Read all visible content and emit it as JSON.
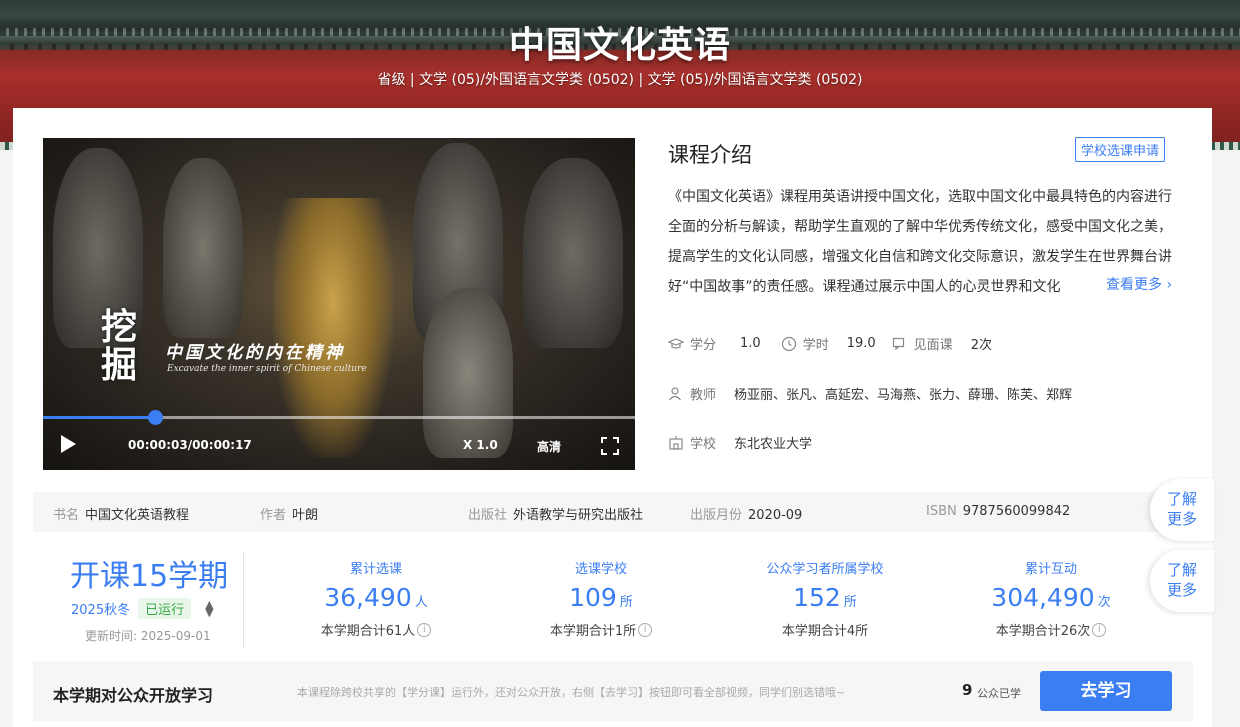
{
  "banner": {
    "title": "中国文化英语",
    "subtitle": "省级 | 文学 (05)/外国语言文学类 (0502) | 文学 (05)/外国语言文学类 (0502)"
  },
  "video": {
    "calligraphy_big": "挖掘",
    "calligraphy_line": "中国文化的内在精神",
    "calligraphy_en": "Excavate the inner spirit of Chinese culture",
    "time": "00:00:03/00:00:17",
    "speed": "X 1.0",
    "quality": "高清",
    "progress": 0.19
  },
  "intro": {
    "heading": "课程介绍",
    "apply_label": "学校选课申请",
    "lines": [
      "《中国文化英语》课程用英语讲授中国文化，选取中国文化中最具特色的内容进行",
      "全面的分析与解读，帮助学生直观的了解中华优秀传统文化，感受中国文化之美，",
      "提高学生的文化认同感，增强文化自信和跨文化交际意识，激发学生在世界舞台讲",
      "好“中国故事”的责任感。课程通过展示中国人的心灵世界和文化"
    ],
    "more_label": "查看更多"
  },
  "meta": {
    "credit_label": "学分",
    "credit_value": "1.0",
    "hours_label": "学时",
    "hours_value": "19.0",
    "meet_label": "见面课",
    "meet_value": "2次",
    "teacher_label": "教师",
    "teachers": "杨亚丽、张凡、高延宏、马海燕、张力、薛珊、陈芙、郑辉",
    "school_label": "学校",
    "school": "东北农业大学"
  },
  "book": {
    "name_label": "书名",
    "name": "中国文化英语教程",
    "author_label": "作者",
    "author": "叶朗",
    "publisher_label": "出版社",
    "publisher": "外语教学与研究出版社",
    "date_label": "出版月份",
    "date": "2020-09",
    "isbn_label": "ISBN",
    "isbn": "9787560099842"
  },
  "side": {
    "learn_more_1": [
      "了解",
      "更多"
    ],
    "learn_more_2": [
      "了解",
      "更多"
    ]
  },
  "term": {
    "big": "开课15学期",
    "semester": "2025秋冬",
    "status": "已运行",
    "update": "更新时间:   2025-09-01"
  },
  "stats": [
    {
      "label": "累计选课",
      "value": "36,490",
      "unit": "人",
      "sum": "本学期合计61人",
      "info": true
    },
    {
      "label": "选课学校",
      "value": "109",
      "unit": "所",
      "sum": "本学期合计1所",
      "info": true
    },
    {
      "label": "公众学习者所属学校",
      "value": "152",
      "unit": "所",
      "sum": "本学期合计4所",
      "info": false
    },
    {
      "label": "累计互动",
      "value": "304,490",
      "unit": "次",
      "sum": "本学期合计26次",
      "info": true
    }
  ],
  "bottom": {
    "title": "本学期对公众开放学习",
    "desc": "本课程除跨校共享的【学分课】运行外，还对公众开放，右侧【去学习】按钮即可看全部视频，同学们别选错哦~",
    "count": "9",
    "count_label": "公众已学",
    "button": "去学习"
  },
  "colors": {
    "accent": "#3b7ef2",
    "status_green": "#3aab48",
    "banner_red": "#a8302c"
  }
}
